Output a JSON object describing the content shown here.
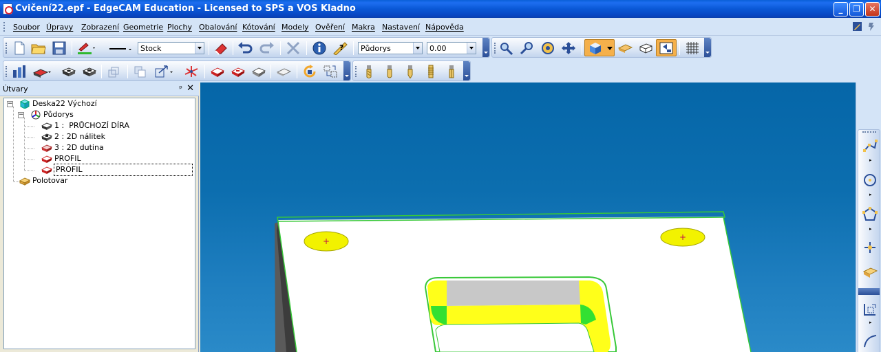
{
  "window": {
    "title": "Cvičení22.epf - EdgeCAM Education - Licensed to SPS a VOS Kladno",
    "minimize_glyph": "_",
    "maximize_glyph": "❐",
    "close_glyph": "✕"
  },
  "menu": {
    "items": [
      "Soubor",
      "Úpravy",
      "Zobrazení",
      "Geometrie",
      "Plochy",
      "Obalování",
      "Kótování",
      "Modely",
      "Ověření",
      "Makra",
      "Nastavení",
      "Nápověda"
    ]
  },
  "toolbar": {
    "layer_combo": "Stock",
    "view_combo": "Půdorys",
    "value_combo": "0.00"
  },
  "panel": {
    "title": "Útvary",
    "pin_glyph": "ᵖ",
    "close_glyph": "✕",
    "tree": {
      "root": "Deska22 Výchozí",
      "cpl": "Půdorys",
      "features": [
        {
          "index": "1 :",
          "label": "PRŮCHOZÍ DÍRA"
        },
        {
          "index": "2 :",
          "label": "2D nálitek"
        },
        {
          "index": "3 :",
          "label": "2D dutina"
        }
      ],
      "profiles": [
        "PROFIL",
        "PROFIL"
      ],
      "stock": "Polotovar"
    }
  },
  "colors": {
    "viewport_bg": "#0566a8",
    "part_face": "#ffffff",
    "part_edge": "#38c838",
    "hole_fill": "#f2f200",
    "pocket_wall": "#ffff1a",
    "pocket_floor": "#c8c8c8"
  },
  "icons": {
    "main_toolbar": [
      "new-file-icon",
      "open-folder-icon",
      "save-icon",
      "color-pen-icon",
      "line-style-icon",
      "eraser-icon",
      "undo-icon",
      "redo-icon",
      "delete-icon",
      "info-icon",
      "measure-icon"
    ],
    "view_toolbar": [
      "zoom-window-icon",
      "zoom-dynamic-icon",
      "rotate-icon",
      "pan-icon",
      "solid-shade-icon",
      "stock-icon",
      "wire-icon",
      "cpl-icon",
      "grid-icon"
    ]
  }
}
